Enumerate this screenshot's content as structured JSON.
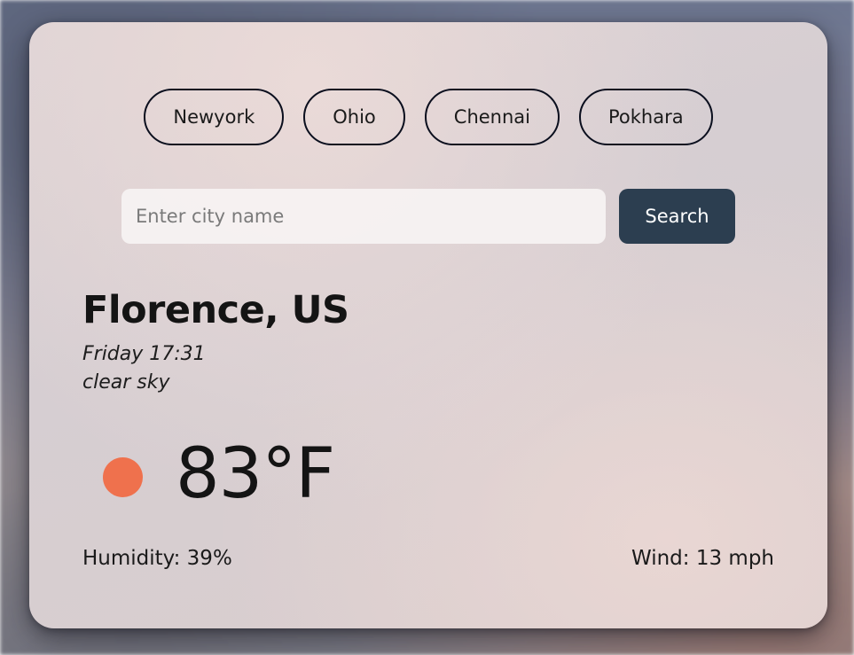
{
  "cities": [
    "Newyork",
    "Ohio",
    "Chennai",
    "Pokhara"
  ],
  "search": {
    "placeholder": "Enter city name",
    "value": "",
    "button_label": "Search"
  },
  "weather": {
    "location": "Florence, US",
    "datetime": "Friday 17:31",
    "description": "clear sky",
    "temperature": "83°F",
    "icon": "sun-icon",
    "icon_color": "#ef714d",
    "humidity": "Humidity: 39%",
    "wind": "Wind: 13 mph"
  },
  "colors": {
    "button_bg": "#2c3e50",
    "chip_border": "#0b0f1e"
  }
}
